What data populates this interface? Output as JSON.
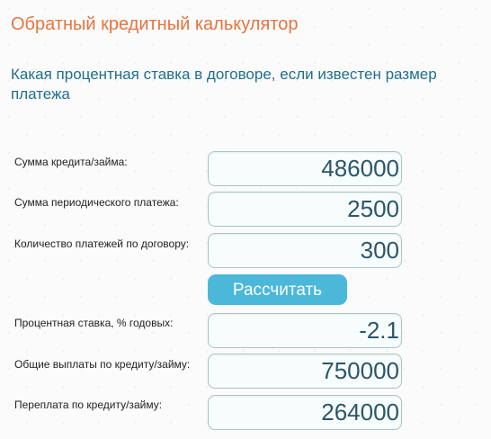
{
  "header": {
    "title": "Обратный кредитный калькулятор",
    "subtitle": "Какая процентная ставка в договоре, если известен размер платежа"
  },
  "inputs": [
    {
      "label": "Сумма кредита/займа:",
      "value": "486000"
    },
    {
      "label": "Сумма периодического платежа:",
      "value": "2500"
    },
    {
      "label": "Количество платежей по договору:",
      "value": "300"
    }
  ],
  "calculate_button": {
    "label": "Рассчитать"
  },
  "results": [
    {
      "label": "Процентная ставка, % годовых:",
      "value": "-2.1"
    },
    {
      "label": "Общие выплаты по кредиту/займу:",
      "value": "750000"
    },
    {
      "label": "Переплата по кредиту/займу:",
      "value": "264000"
    }
  ],
  "colors": {
    "title": "#e8733d",
    "subtitle": "#1f6f8b",
    "button": "#4bb8da",
    "field_text": "#2b5668"
  }
}
